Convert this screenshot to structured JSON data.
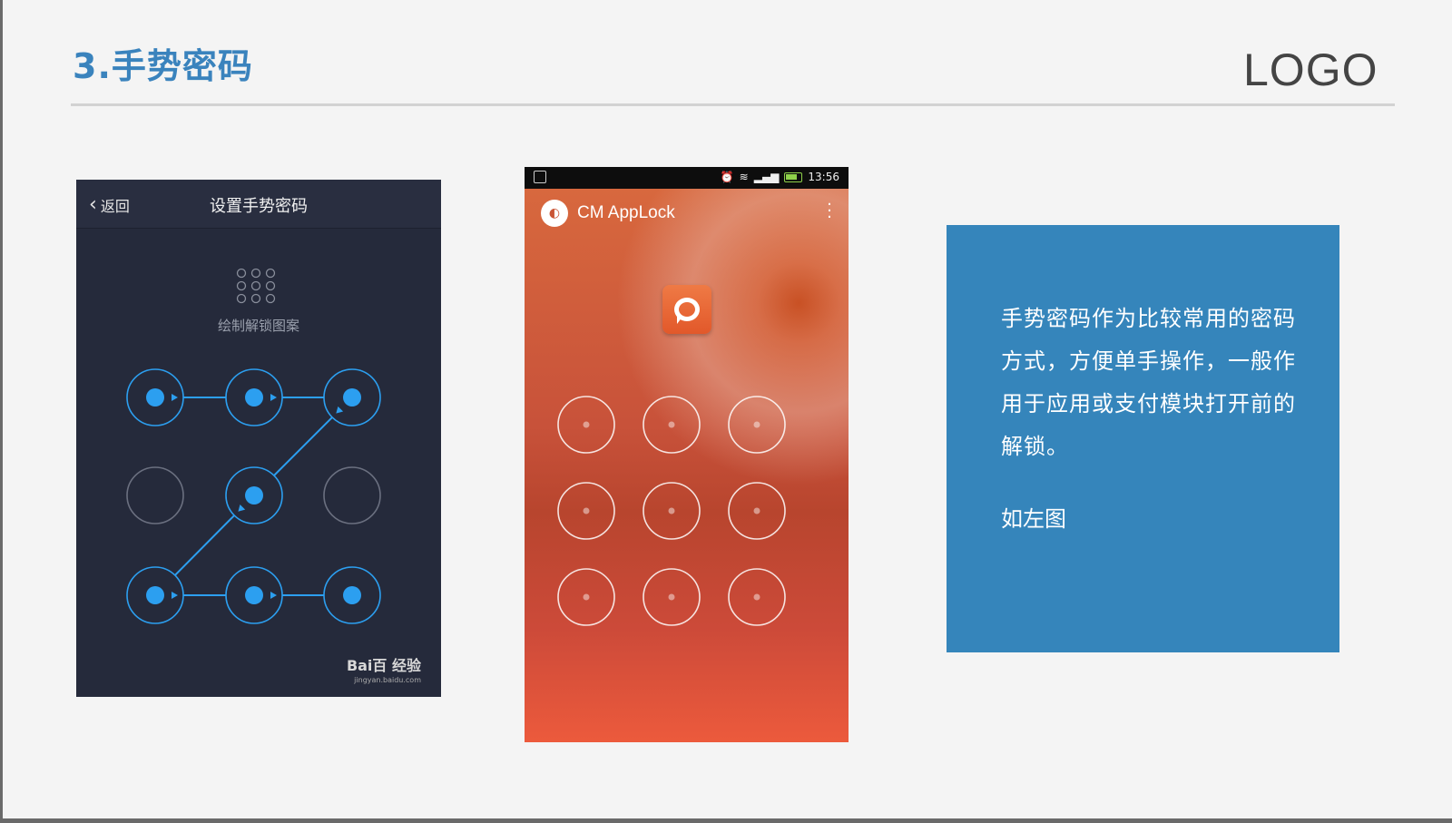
{
  "slide": {
    "title": "3.手势密码",
    "logo": "LOGO"
  },
  "phone_setup": {
    "back_label": "返回",
    "title": "设置手势密码",
    "hint": "绘制解锁图案",
    "watermark": "Bai百 经验",
    "watermark_url": "jingyan.baidu.com",
    "pattern_path": [
      1,
      2,
      3,
      5,
      7,
      8,
      9
    ],
    "colors": {
      "background": "#252a3b",
      "accent": "#2c9ff0"
    }
  },
  "phone_applock": {
    "status_time": "13:56",
    "app_name": "CM AppLock",
    "colors": {
      "accent": "#e2582a"
    }
  },
  "description": {
    "text": "手势密码作为比较常用的密码方式，方便单手操作，一般作用于应用或支付模块打开前的解锁。",
    "note": "如左图",
    "colors": {
      "background": "#3585bb"
    }
  }
}
